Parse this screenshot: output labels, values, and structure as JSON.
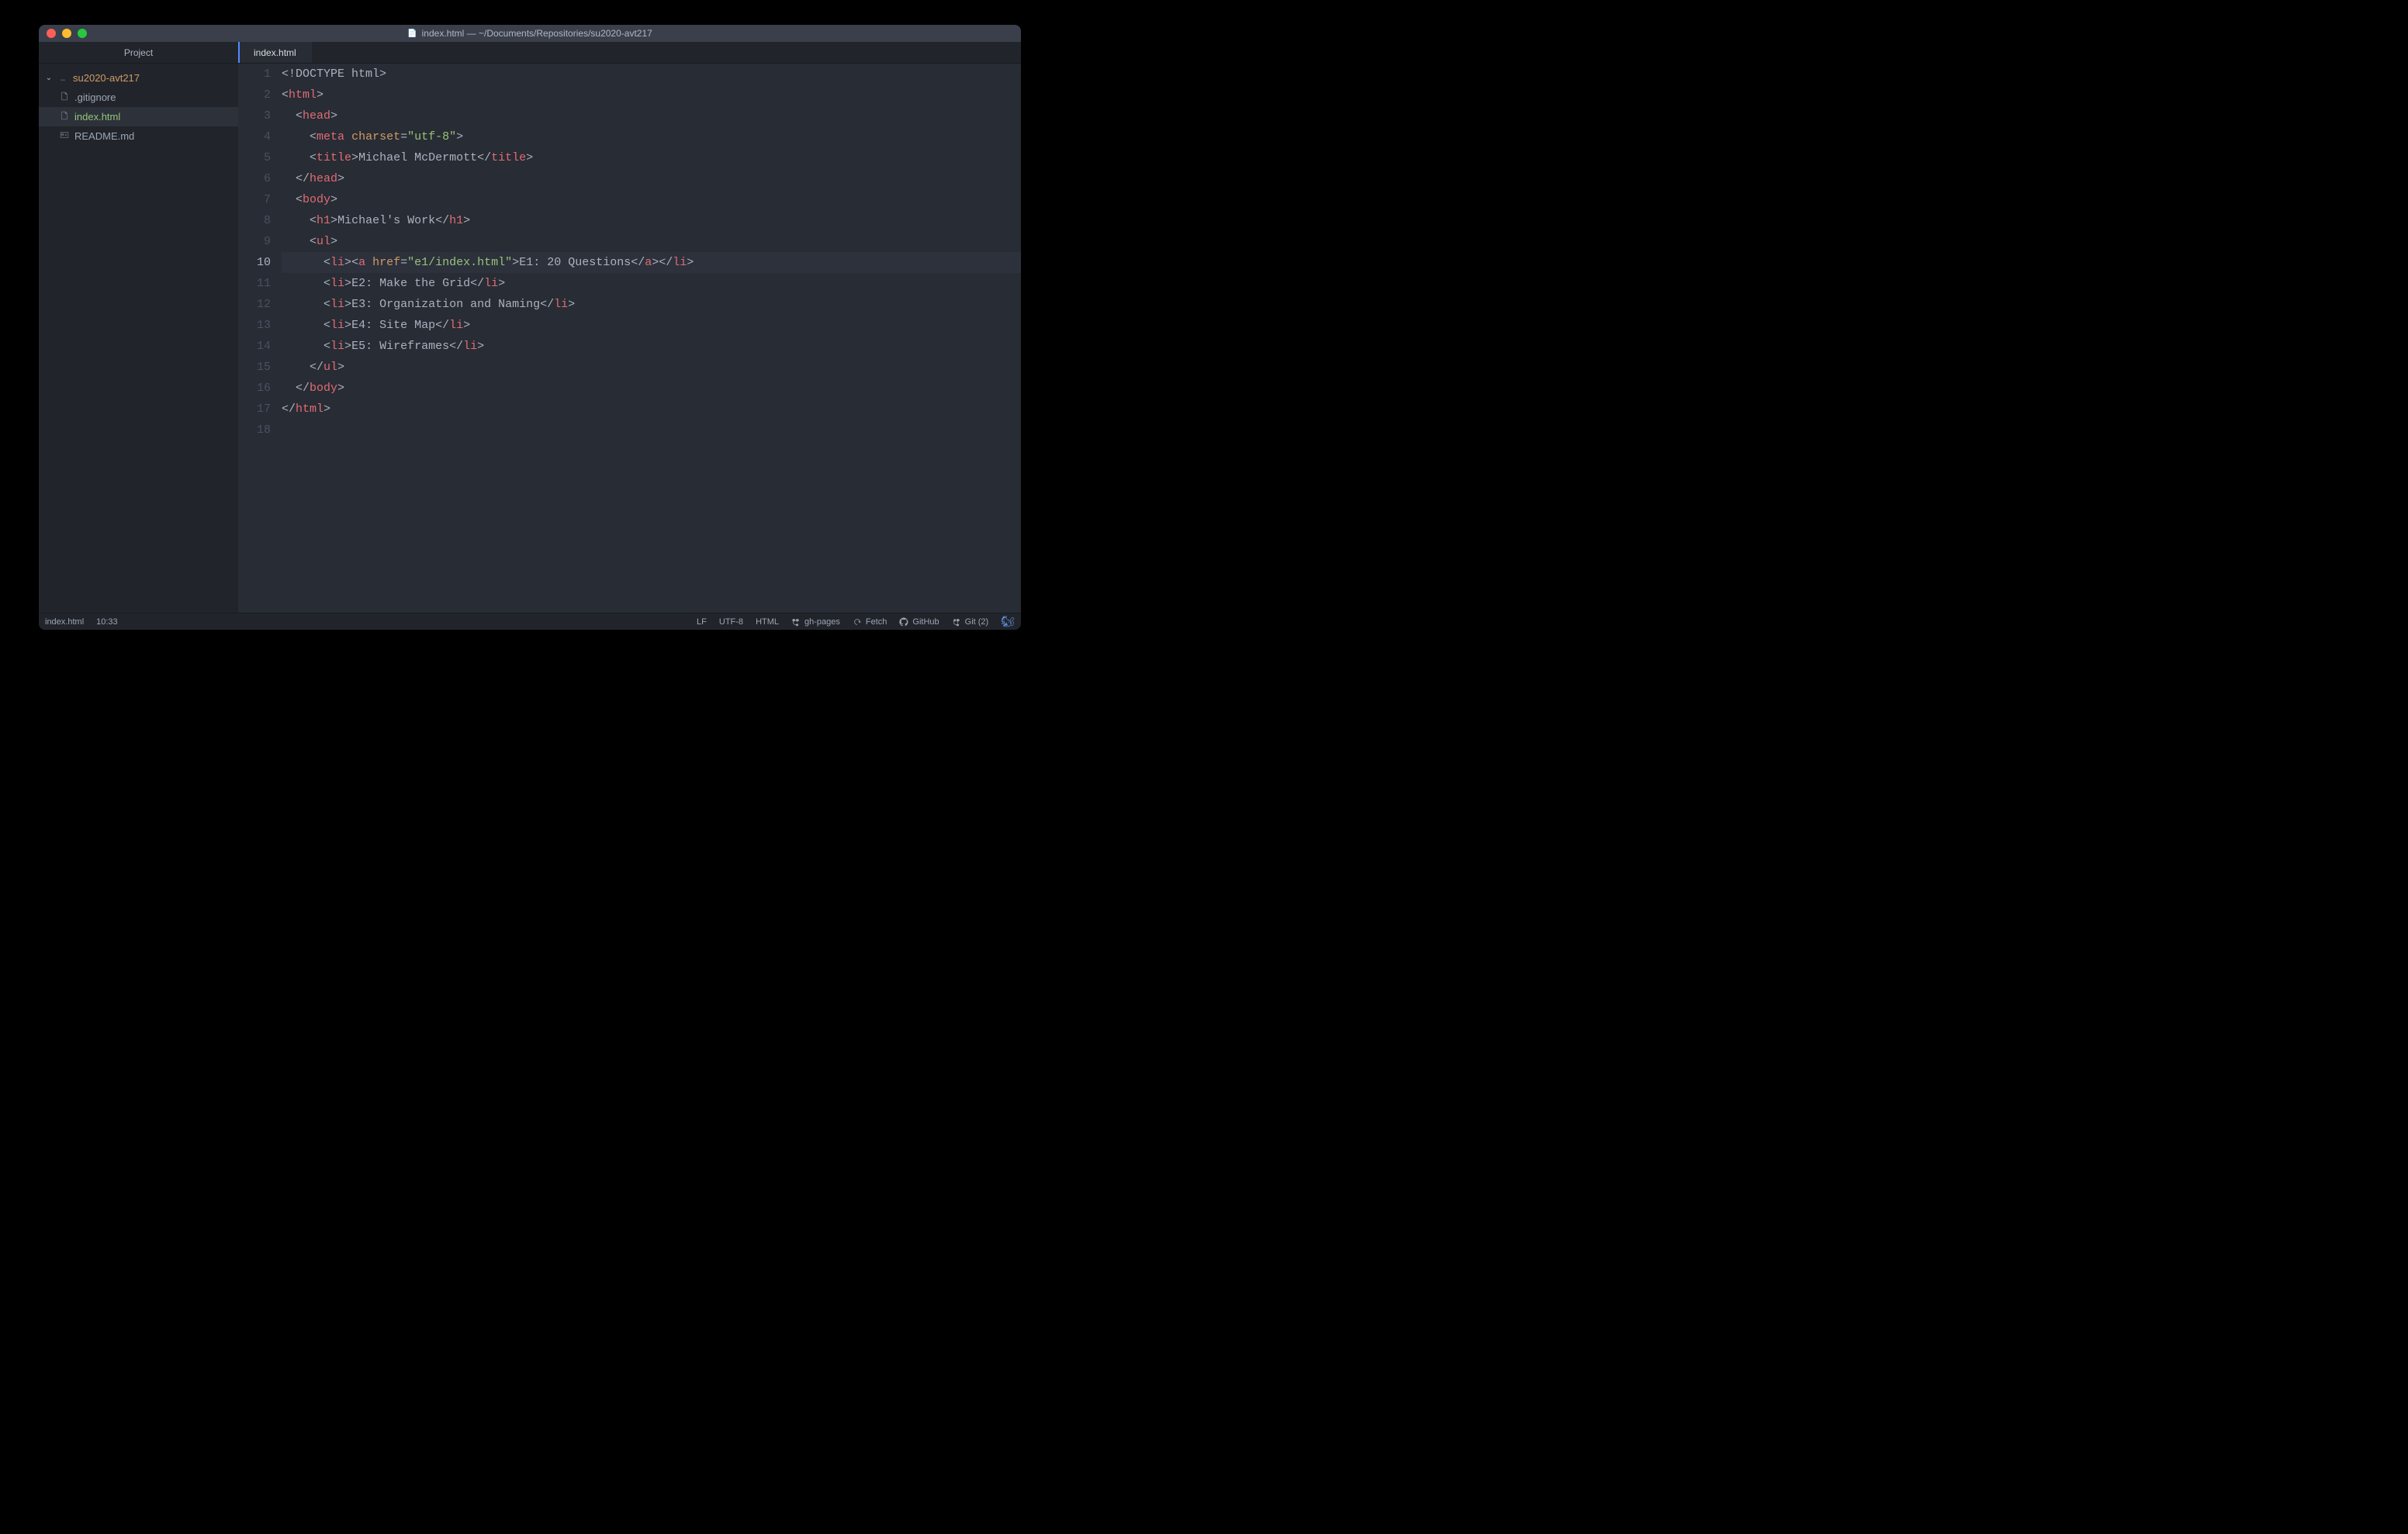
{
  "window": {
    "title": "index.html — ~/Documents/Repositories/su2020-avt217"
  },
  "sidebar": {
    "tab_label": "Project",
    "project_name": "su2020-avt217",
    "files": [
      {
        "name": ".gitignore",
        "color": "grey"
      },
      {
        "name": "index.html",
        "color": "green",
        "selected": true
      },
      {
        "name": "README.md",
        "color": "grey"
      }
    ]
  },
  "editor": {
    "tab": "index.html",
    "current_line": 10,
    "line_count": 18,
    "code": {
      "l1": {
        "doctype": "<!DOCTYPE html>"
      },
      "l2": {
        "open": "<",
        "tag": "html",
        "close": ">"
      },
      "l3": {
        "open": "<",
        "tag": "head",
        "close": ">"
      },
      "l4": {
        "open": "<",
        "tag": "meta",
        "sp": " ",
        "attr": "charset",
        "eq": "=",
        "str": "\"utf-8\"",
        "close": ">"
      },
      "l5": {
        "open": "<",
        "tag": "title",
        "close": ">",
        "text": "Michael McDermott",
        "open2": "</",
        "tag2": "title",
        "close2": ">"
      },
      "l6": {
        "open": "</",
        "tag": "head",
        "close": ">"
      },
      "l7": {
        "open": "<",
        "tag": "body",
        "close": ">"
      },
      "l8": {
        "open": "<",
        "tag": "h1",
        "close": ">",
        "text": "Michael's Work",
        "open2": "</",
        "tag2": "h1",
        "close2": ">"
      },
      "l9": {
        "open": "<",
        "tag": "ul",
        "close": ">"
      },
      "l10": {
        "open": "<",
        "tag": "li",
        "close": ">",
        "aopen": "<",
        "atag": "a",
        "sp": " ",
        "attr": "href",
        "eq": "=",
        "str": "\"e1/index.html\"",
        "aclose": ">",
        "text": "E1: 20 Questions",
        "aopen2": "</",
        "atag2": "a",
        "aclose2": ">",
        "open2": "</",
        "tag2": "li",
        "close2": ">"
      },
      "l11": {
        "open": "<",
        "tag": "li",
        "close": ">",
        "text": "E2: Make the Grid",
        "open2": "</",
        "tag2": "li",
        "close2": ">"
      },
      "l12": {
        "open": "<",
        "tag": "li",
        "close": ">",
        "text": "E3: Organization and Naming",
        "open2": "</",
        "tag2": "li",
        "close2": ">"
      },
      "l13": {
        "open": "<",
        "tag": "li",
        "close": ">",
        "text": "E4: Site Map",
        "open2": "</",
        "tag2": "li",
        "close2": ">"
      },
      "l14": {
        "open": "<",
        "tag": "li",
        "close": ">",
        "text": "E5: Wireframes",
        "open2": "</",
        "tag2": "li",
        "close2": ">"
      },
      "l15": {
        "open": "</",
        "tag": "ul",
        "close": ">"
      },
      "l16": {
        "open": "</",
        "tag": "body",
        "close": ">"
      },
      "l17": {
        "open": "</",
        "tag": "html",
        "close": ">"
      }
    }
  },
  "status": {
    "file": "index.html",
    "cursor": "10:33",
    "eol": "LF",
    "encoding": "UTF-8",
    "language": "HTML",
    "branch": "gh-pages",
    "fetch": "Fetch",
    "github": "GitHub",
    "git": "Git (2)"
  }
}
